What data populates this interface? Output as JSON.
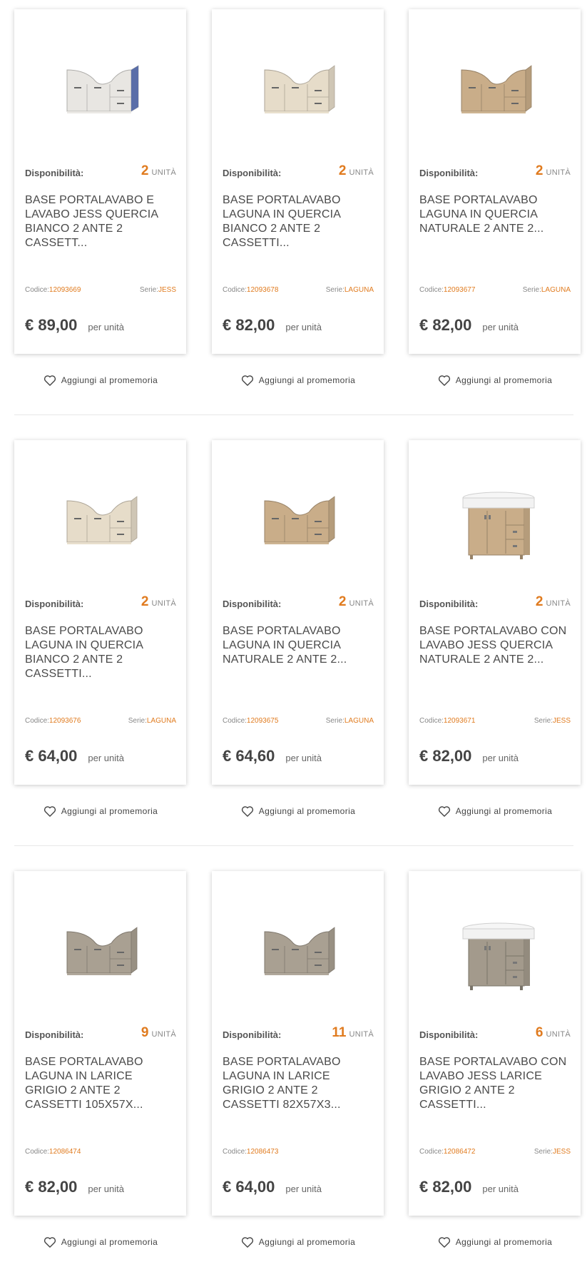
{
  "labels": {
    "availability": "Disponibilità:",
    "unit": "UNITÀ",
    "codice": "Codice:",
    "serie": "Serie:",
    "per_unit": "per unità",
    "wishlist": "Aggiungi al promemoria"
  },
  "products": [
    {
      "qty": "2",
      "title": "BASE PORTALAVABO E LAVABO JESS QUERCIA BIANCO 2 ANTE 2 CASSETT...",
      "codice": "12093669",
      "serie": "JESS",
      "price": "€ 89,00",
      "image": "vanity-white-oak-sink-icon",
      "tone": "#e8e6e2",
      "style": "sink"
    },
    {
      "qty": "2",
      "title": "BASE PORTALAVABO LAGUNA IN QUERCIA BIANCO 2 ANTE 2 CASSETTI...",
      "codice": "12093678",
      "serie": "LAGUNA",
      "price": "€ 82,00",
      "image": "vanity-white-oak-icon",
      "tone": "#e6dcc9",
      "style": "base"
    },
    {
      "qty": "2",
      "title": "BASE PORTALAVABO LAGUNA IN QUERCIA NATURALE 2 ANTE 2...",
      "codice": "12093677",
      "serie": "LAGUNA",
      "price": "€ 82,00",
      "image": "vanity-natural-oak-icon",
      "tone": "#c9ad89",
      "style": "base"
    },
    {
      "qty": "2",
      "title": "BASE PORTALAVABO LAGUNA IN QUERCIA BIANCO 2 ANTE 2 CASSETTI...",
      "codice": "12093676",
      "serie": "LAGUNA",
      "price": "€ 64,00",
      "image": "vanity-white-oak-icon",
      "tone": "#e6dcc9",
      "style": "base"
    },
    {
      "qty": "2",
      "title": "BASE PORTALAVABO LAGUNA IN QUERCIA NATURALE 2 ANTE 2...",
      "codice": "12093675",
      "serie": "LAGUNA",
      "price": "€ 64,60",
      "image": "vanity-natural-oak-icon",
      "tone": "#c9ad89",
      "style": "base"
    },
    {
      "qty": "2",
      "title": "BASE PORTALAVABO CON LAVABO JESS QUERCIA NATURALE 2 ANTE 2...",
      "codice": "12093671",
      "serie": "JESS",
      "price": "€ 82,00",
      "image": "vanity-natural-oak-basin-icon",
      "tone": "#c9ad89",
      "style": "basin"
    },
    {
      "qty": "9",
      "title": "BASE PORTALAVABO LAGUNA IN LARICE GRIGIO 2 ANTE 2 CASSETTI 105X57X...",
      "codice": "12086474",
      "serie": "",
      "price": "€ 82,00",
      "image": "vanity-grey-larch-icon",
      "tone": "#a9a092",
      "style": "base"
    },
    {
      "qty": "11",
      "title": "BASE PORTALAVABO LAGUNA IN LARICE GRIGIO 2 ANTE 2 CASSETTI 82X57X3...",
      "codice": "12086473",
      "serie": "",
      "price": "€ 64,00",
      "image": "vanity-grey-larch-icon",
      "tone": "#a9a092",
      "style": "base"
    },
    {
      "qty": "6",
      "title": "BASE PORTALAVABO CON LAVABO JESS LARICE GRIGIO 2 ANTE 2 CASSETTI...",
      "codice": "12086472",
      "serie": "JESS",
      "price": "€ 82,00",
      "image": "vanity-grey-larch-basin-icon",
      "tone": "#a39a8c",
      "style": "basin"
    }
  ],
  "colors": {
    "accent": "#e07b1f",
    "text": "#444444",
    "divider": "#e8e8e8"
  }
}
